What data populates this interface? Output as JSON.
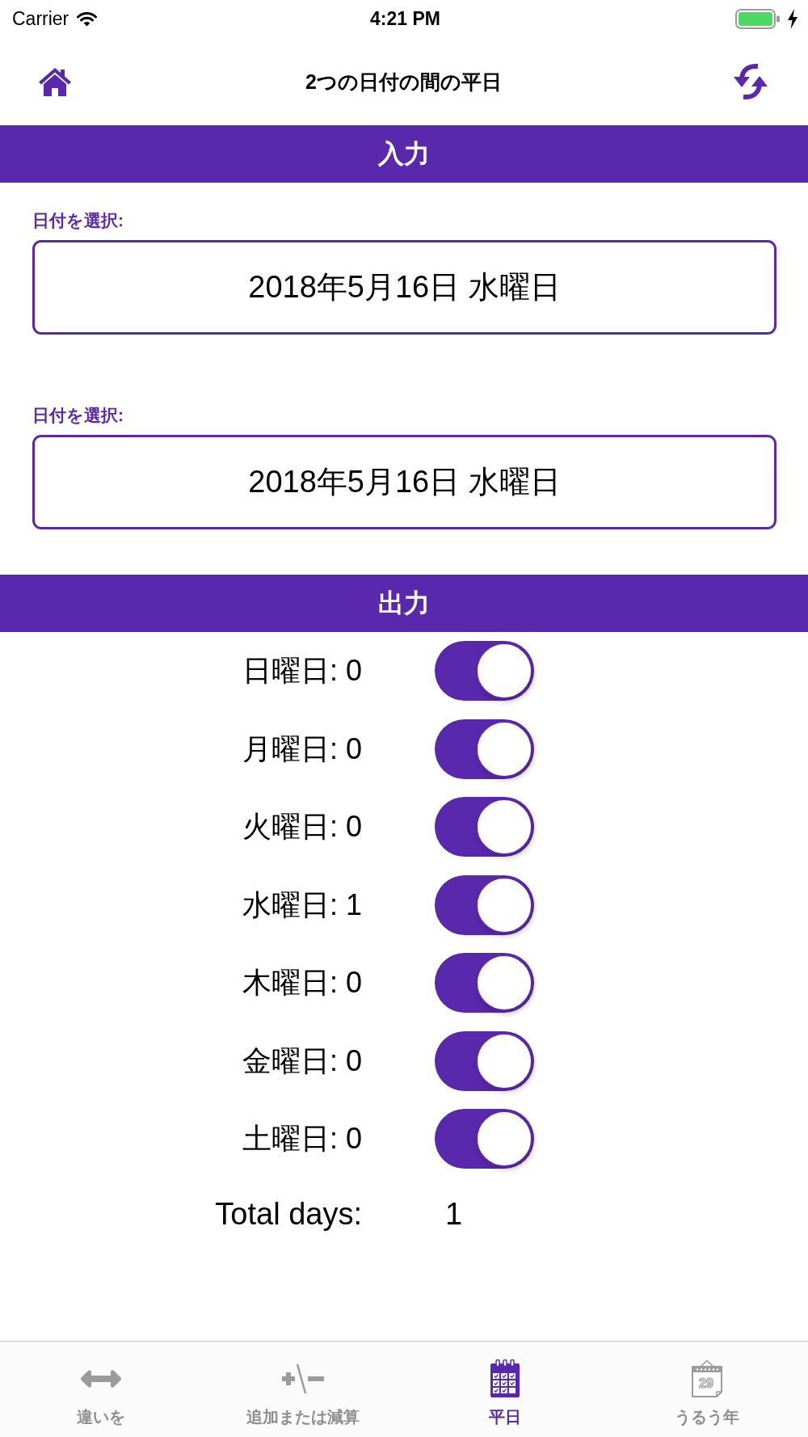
{
  "status_bar": {
    "carrier": "Carrier",
    "time": "4:21 PM"
  },
  "nav": {
    "title": "2つの日付の間の平日"
  },
  "input_section": {
    "title": "入力",
    "fields": [
      {
        "label": "日付を選択:",
        "value": "2018年5月16日 水曜日"
      },
      {
        "label": "日付を選択:",
        "value": "2018年5月16日 水曜日"
      }
    ]
  },
  "output_section": {
    "title": "出力",
    "days": [
      {
        "label": "日曜日: 0",
        "on": true
      },
      {
        "label": "月曜日: 0",
        "on": true
      },
      {
        "label": "火曜日: 0",
        "on": true
      },
      {
        "label": "水曜日: 1",
        "on": true
      },
      {
        "label": "木曜日: 0",
        "on": true
      },
      {
        "label": "金曜日: 0",
        "on": true
      },
      {
        "label": "土曜日: 0",
        "on": true
      }
    ],
    "total": {
      "label": "Total days:",
      "value": "1"
    }
  },
  "tab_bar": {
    "tabs": [
      {
        "kind": "swap",
        "label": "違いを",
        "selected": false
      },
      {
        "kind": "plus-minus",
        "label": "追加または減算",
        "selected": false
      },
      {
        "kind": "calendar",
        "label": "平日",
        "selected": true
      },
      {
        "kind": "leap",
        "label": "うるう年",
        "selected": false,
        "icon_text": "29"
      }
    ]
  }
}
